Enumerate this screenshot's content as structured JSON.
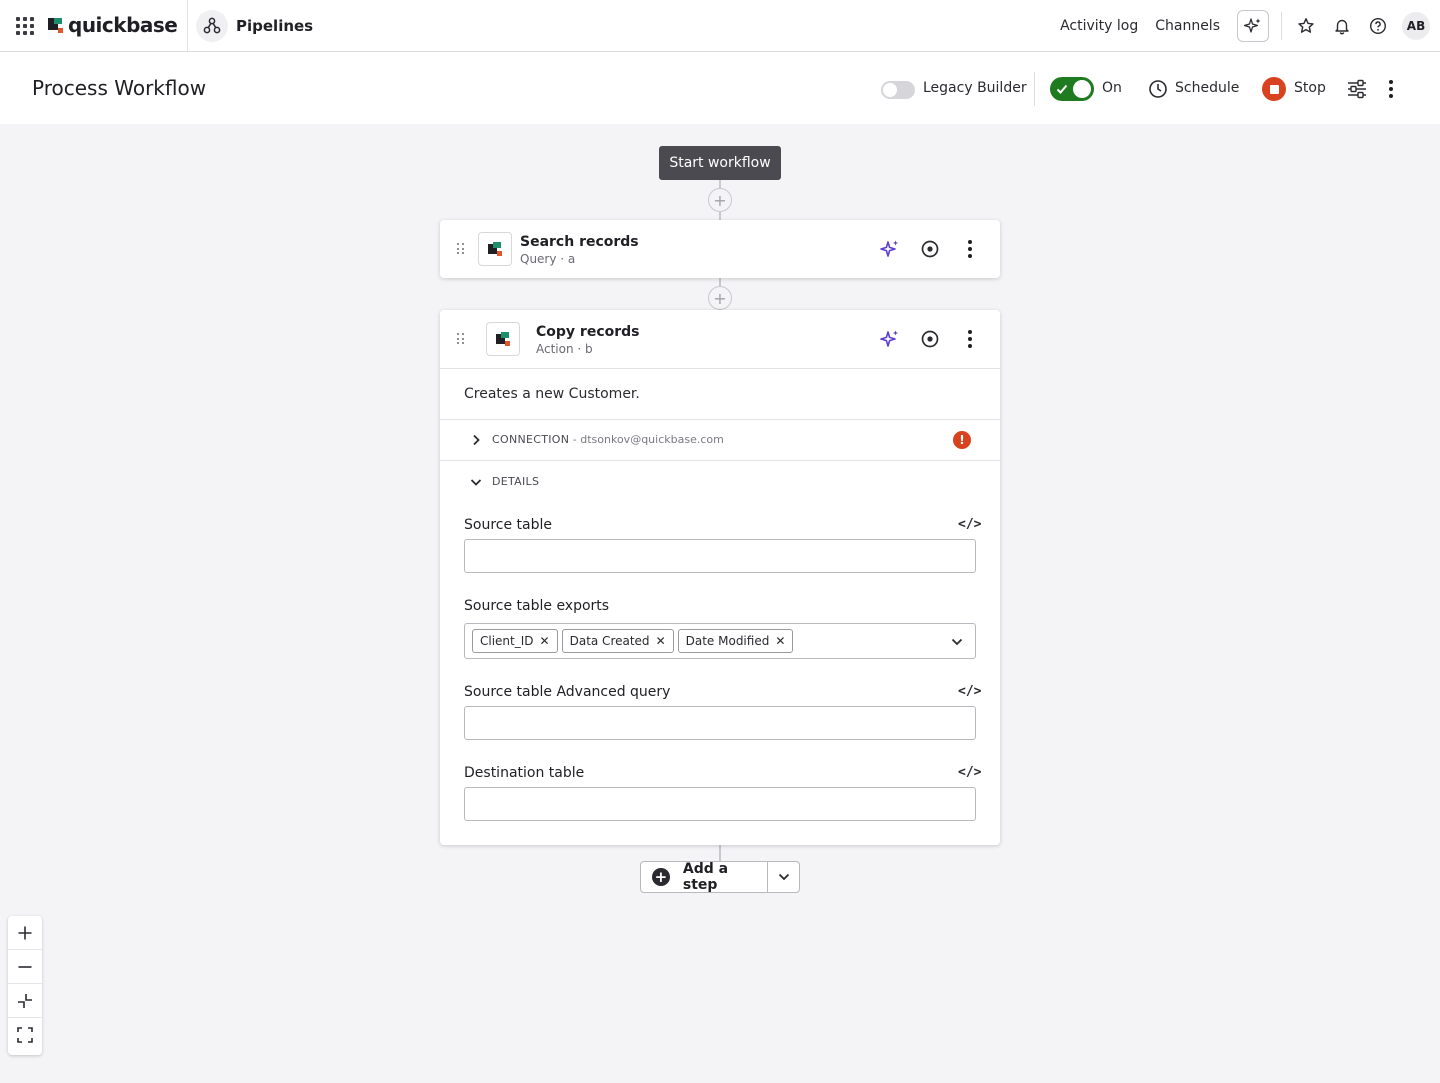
{
  "nav": {
    "logo_text": "quickbase",
    "app_label": "Pipelines",
    "links": [
      "Activity log",
      "Channels"
    ],
    "avatar_initials": "AB"
  },
  "header": {
    "title": "Process Workflow",
    "legacy_label": "Legacy Builder",
    "on_label": "On",
    "schedule_label": "Schedule",
    "stop_label": "Stop"
  },
  "canvas": {
    "start_label": "Start workflow",
    "steps": [
      {
        "title": "Search records",
        "subtitle": "Query · a"
      },
      {
        "title": "Copy records",
        "subtitle": "Action · b"
      }
    ],
    "copy_step": {
      "description": "Creates a new Customer.",
      "connection_label": "CONNECTION",
      "connection_email": " - dtsonkov@quickbase.com",
      "details_label": "DETAILS",
      "fields": {
        "source_table": {
          "label": "Source table",
          "value": ""
        },
        "source_exports": {
          "label": "Source table exports",
          "tags": [
            "Client_ID",
            "Data Created",
            "Date Modified"
          ]
        },
        "advanced_query": {
          "label": "Source table Advanced query",
          "value": ""
        },
        "destination_table": {
          "label": "Destination table",
          "value": ""
        }
      },
      "code_glyph": "</>"
    },
    "add_step_label": "Add a step"
  },
  "colors": {
    "toggle_on": "#1e7b1f",
    "stop": "#d8421f",
    "sparkle": "#5b3fd1",
    "warning": "#d8421f"
  },
  "icons": [
    "apps-grid-icon",
    "pipelines-icon",
    "ai-sparkle-icon",
    "star-icon",
    "bell-icon",
    "help-icon",
    "clock-icon",
    "stop-icon",
    "sliders-icon",
    "kebab-icon",
    "drag-handle-icon",
    "eye-icon",
    "chevron-right-icon",
    "chevron-down-icon",
    "code-icon",
    "plus-icon",
    "minus-icon",
    "fit-icon",
    "fullscreen-icon"
  ]
}
